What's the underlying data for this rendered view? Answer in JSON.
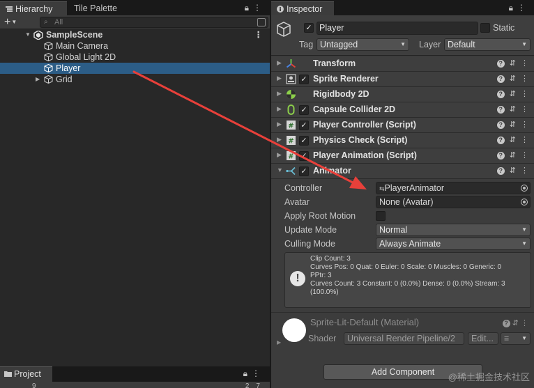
{
  "hierarchy": {
    "tabs": [
      "Hierarchy",
      "Tile Palette"
    ],
    "search_placeholder": "All",
    "add_label": "+",
    "scene": "SampleScene",
    "objects": [
      "Main Camera",
      "Global Light 2D",
      "Player",
      "Grid"
    ],
    "selected": "Player"
  },
  "project": {
    "tab": "Project",
    "search_fragment": "9",
    "hidden_count": "27"
  },
  "inspector": {
    "tab": "Inspector",
    "object_name": "Player",
    "active": true,
    "static_label": "Static",
    "tag_label": "Tag",
    "tag_value": "Untagged",
    "layer_label": "Layer",
    "layer_value": "Default",
    "components": [
      {
        "name": "Transform",
        "icon": "transform-icon",
        "has_checkbox": false
      },
      {
        "name": "Sprite Renderer",
        "icon": "sprite-renderer-icon",
        "has_checkbox": true
      },
      {
        "name": "Rigidbody 2D",
        "icon": "rigidbody-icon",
        "has_checkbox": false
      },
      {
        "name": "Capsule Collider 2D",
        "icon": "capsule-collider-icon",
        "has_checkbox": true
      },
      {
        "name": "Player Controller (Script)",
        "icon": "script-icon",
        "has_checkbox": true
      },
      {
        "name": "Physics Check (Script)",
        "icon": "script-icon",
        "has_checkbox": true
      },
      {
        "name": "Player Animation (Script)",
        "icon": "script-icon",
        "has_checkbox": true
      },
      {
        "name": "Animator",
        "icon": "animator-icon",
        "has_checkbox": true
      }
    ],
    "animator": {
      "controller_label": "Controller",
      "controller_value": "PlayerAnimator",
      "avatar_label": "Avatar",
      "avatar_value": "None (Avatar)",
      "root_motion_label": "Apply Root Motion",
      "update_mode_label": "Update Mode",
      "update_mode_value": "Normal",
      "culling_mode_label": "Culling Mode",
      "culling_mode_value": "Always Animate",
      "info_lines": [
        "Clip Count: 3",
        "Curves Pos: 0 Quat: 0 Euler: 0 Scale: 0 Muscles: 0 Generic: 0",
        "PPtr: 3",
        "Curves Count: 3 Constant: 0 (0.0%) Dense: 0 (0.0%) Stream: 3",
        "(100.0%)"
      ]
    },
    "material": {
      "name": "Sprite-Lit-Default (Material)",
      "shader_label": "Shader",
      "shader_value": "Universal Render Pipeline/2",
      "edit_label": "Edit..."
    },
    "add_component_label": "Add Component"
  },
  "watermark": "@稀土掘金技术社区",
  "colors": {
    "selection": "#2c5d87",
    "annotation_arrow": "#e8403a"
  }
}
